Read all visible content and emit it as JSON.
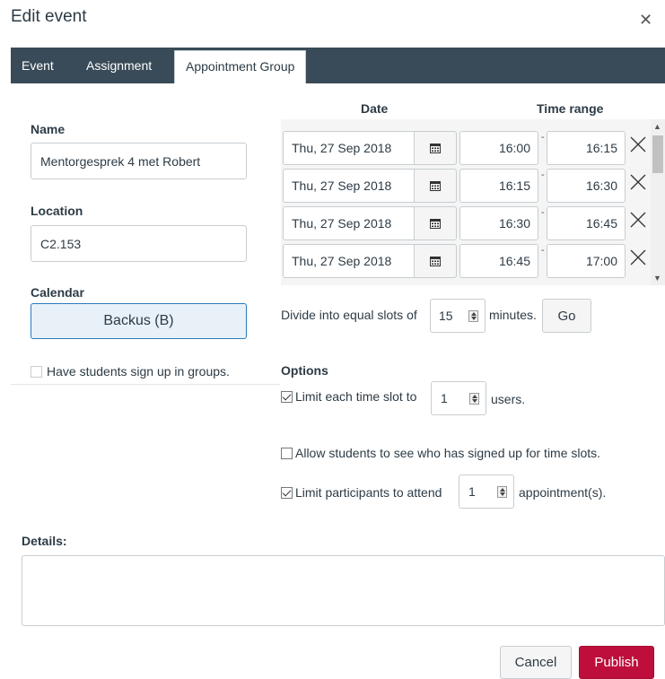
{
  "dialog": {
    "title": "Edit event",
    "close_icon": "close-icon"
  },
  "tabs": [
    {
      "label": "Event"
    },
    {
      "label": "Assignment"
    },
    {
      "label": "Appointment Group",
      "active": true
    }
  ],
  "form": {
    "name_label": "Name",
    "name_value": "Mentorgesprek 4 met Robert",
    "location_label": "Location",
    "location_value": "C2.153",
    "calendar_label": "Calendar",
    "calendar_value": "Backus (B)",
    "groups_label": "Have students sign up in groups."
  },
  "slots": {
    "date_header": "Date",
    "time_header": "Time range",
    "rows": [
      {
        "date": "Thu, 27 Sep 2018",
        "start": "16:00",
        "end": "16:15"
      },
      {
        "date": "Thu, 27 Sep 2018",
        "start": "16:15",
        "end": "16:30"
      },
      {
        "date": "Thu, 27 Sep 2018",
        "start": "16:30",
        "end": "16:45"
      },
      {
        "date": "Thu, 27 Sep 2018",
        "start": "16:45",
        "end": "17:00"
      }
    ],
    "divide_label": "Divide into equal slots of",
    "divide_value": "15",
    "divide_unit": "minutes.",
    "go_label": "Go"
  },
  "options": {
    "title": "Options",
    "limit_slot_label": "Limit each time slot to",
    "limit_slot_value": "1",
    "limit_slot_unit": "users.",
    "allow_see_label": "Allow students to see who has signed up for time slots.",
    "limit_participants_label": "Limit participants to attend",
    "limit_participants_value": "1",
    "limit_participants_unit": "appointment(s)."
  },
  "details": {
    "label": "Details:"
  },
  "footer": {
    "cancel_label": "Cancel",
    "publish_label": "Publish",
    "publish_color": "#be0f3c"
  }
}
